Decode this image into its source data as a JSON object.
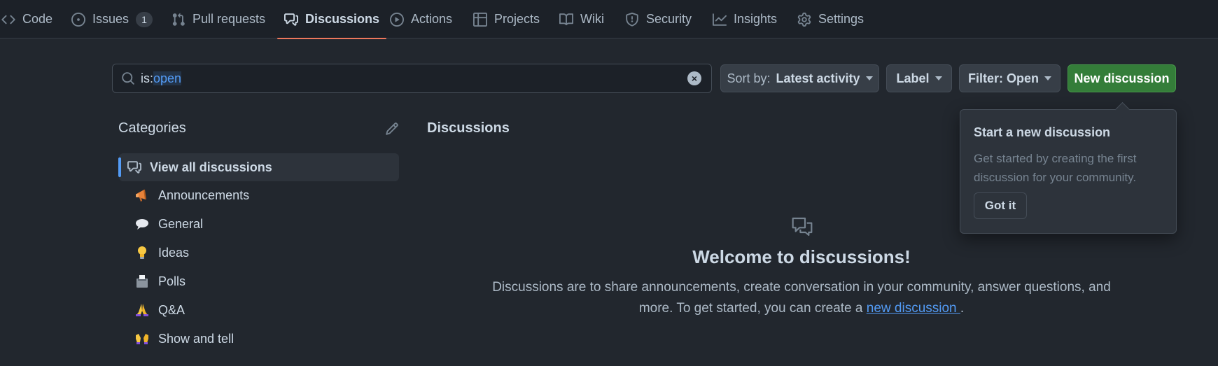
{
  "nav": {
    "tabs": [
      {
        "label": "Code",
        "icon": "code-icon"
      },
      {
        "label": "Issues",
        "icon": "issue-opened-icon",
        "count": "1"
      },
      {
        "label": "Pull requests",
        "icon": "git-pull-request-icon"
      },
      {
        "label": "Discussions",
        "icon": "comment-discussion-icon",
        "active": true
      },
      {
        "label": "Actions",
        "icon": "play-icon"
      },
      {
        "label": "Projects",
        "icon": "table-icon"
      },
      {
        "label": "Wiki",
        "icon": "book-icon"
      },
      {
        "label": "Security",
        "icon": "shield-icon"
      },
      {
        "label": "Insights",
        "icon": "graph-icon"
      },
      {
        "label": "Settings",
        "icon": "gear-icon"
      }
    ]
  },
  "toolbar": {
    "search_prefix": "is:",
    "search_query": "open",
    "sort_label": "Sort by:",
    "sort_value": "Latest activity",
    "label_button": "Label",
    "filter_button": "Filter: Open",
    "new_discussion": "New discussion"
  },
  "categories": {
    "title": "Categories",
    "items": [
      {
        "label": "View all discussions",
        "icon": "comment-discussion-icon",
        "selected": true
      },
      {
        "label": "Announcements",
        "icon": "megaphone-emoji"
      },
      {
        "label": "General",
        "icon": "speech-balloon-emoji"
      },
      {
        "label": "Ideas",
        "icon": "light-bulb-emoji"
      },
      {
        "label": "Polls",
        "icon": "ballot-box-emoji"
      },
      {
        "label": "Q&A",
        "icon": "folded-hands-emoji"
      },
      {
        "label": "Show and tell",
        "icon": "raising-hands-emoji"
      }
    ]
  },
  "main": {
    "title": "Discussions",
    "welcome": "Welcome to discussions!",
    "description_line1": "Discussions are to share announcements, create conversation in your community, answer questions, and",
    "description_line2": "more. To get started, you can create a",
    "link": "new discussion ",
    "description_end": "."
  },
  "popover": {
    "title": "Start a new discussion",
    "body": "Get started by creating the first discussion for your community.",
    "button": "Got it"
  },
  "colors": {
    "background": "#22272e",
    "accent_green": "#347d39",
    "link_blue": "#539bf5",
    "active_tab_underline": "#ec775c"
  }
}
